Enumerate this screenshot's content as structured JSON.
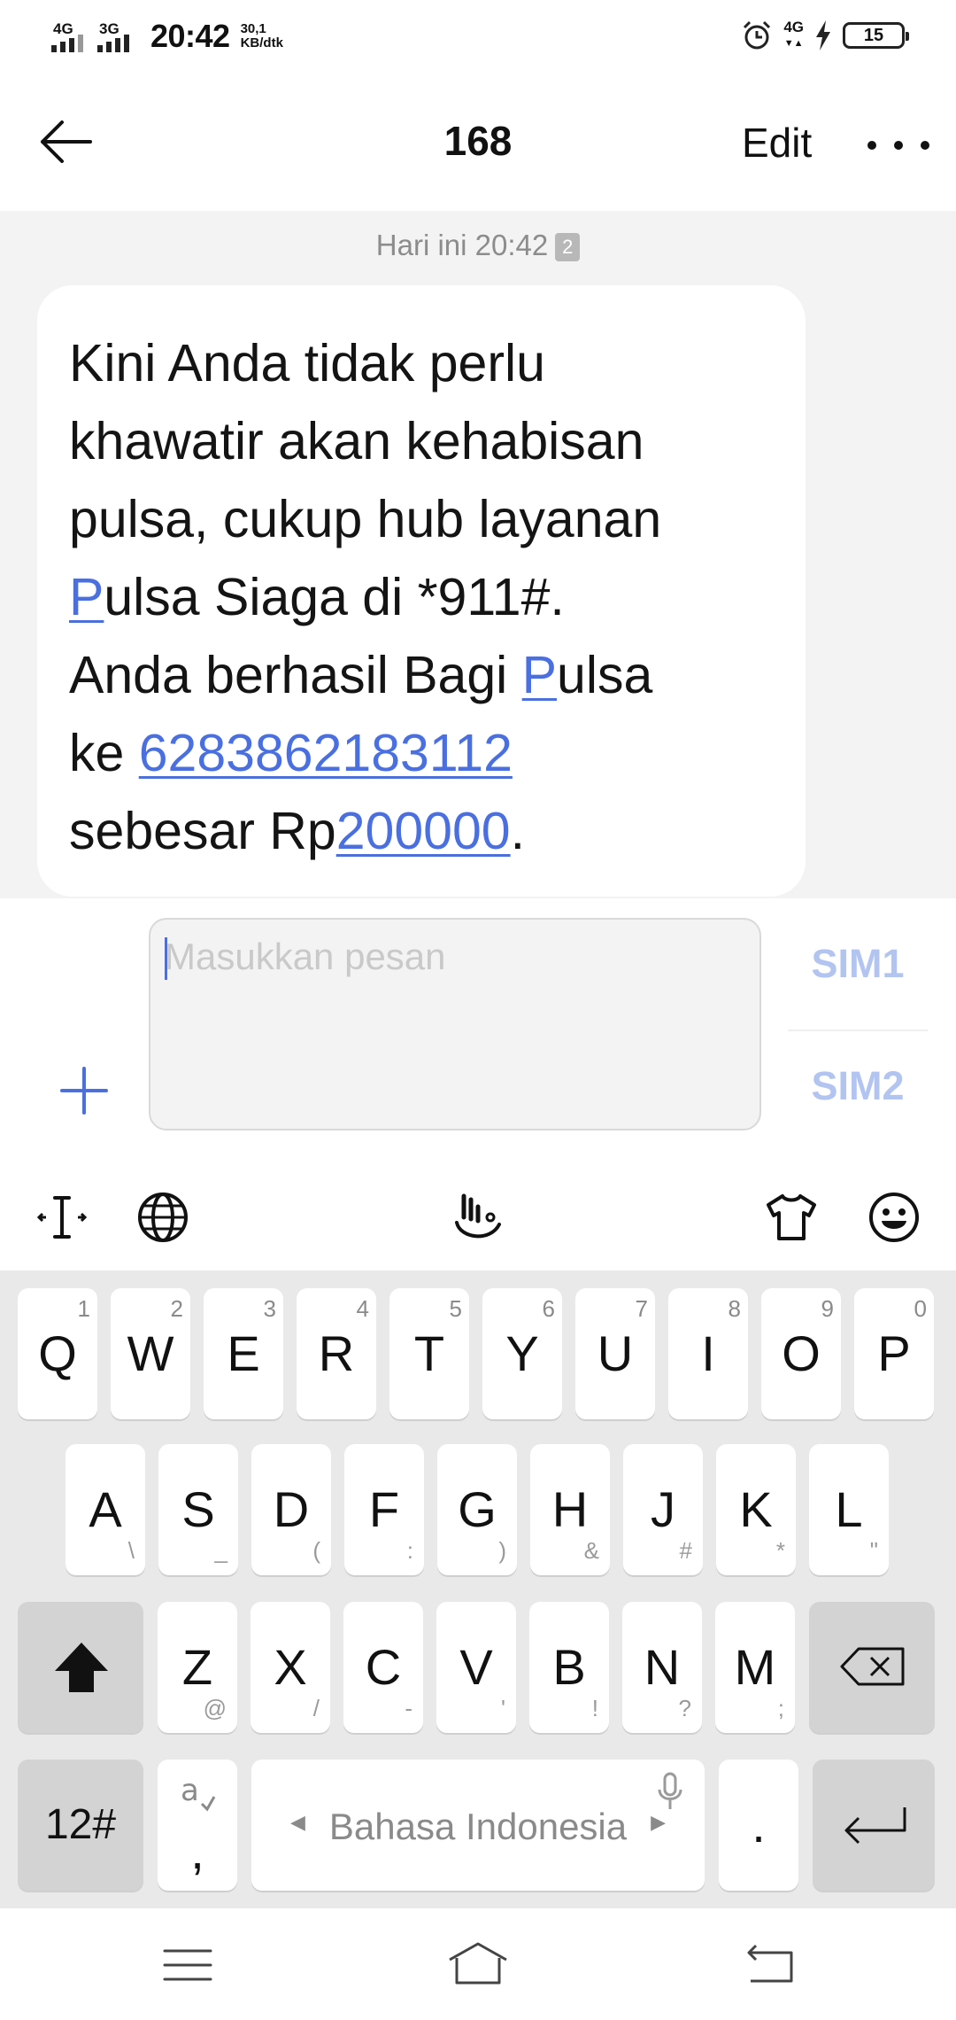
{
  "status_bar": {
    "sim1_network": "4G",
    "sim2_network": "3G",
    "time": "20:42",
    "speed_value": "30,1",
    "speed_unit": "KB/dtk",
    "network_right": "4G",
    "battery_level": "15"
  },
  "header": {
    "title": "168",
    "edit_label": "Edit"
  },
  "conversation": {
    "timestamp": "Hari ini 20:42",
    "sim_badge": "2",
    "message": {
      "line1": "Kini Anda tidak perlu",
      "line2": "khawatir akan kehabisan",
      "line3": "pulsa, cukup hub layanan",
      "line4_link": "P",
      "line4_rest": "ulsa Siaga di *911#.",
      "line5_text": "Anda berhasil Bagi ",
      "line5_link": "P",
      "line5_rest": "ulsa",
      "line6_text": "ke ",
      "line6_link": "6283862183112",
      "line7_text": "sebesar Rp",
      "line7_link": "200000",
      "line7_end": "."
    }
  },
  "compose": {
    "placeholder": "Masukkan pesan",
    "sim1_label": "SIM1",
    "sim2_label": "SIM2"
  },
  "keyboard": {
    "row1": [
      {
        "main": "Q",
        "hint": "1"
      },
      {
        "main": "W",
        "hint": "2"
      },
      {
        "main": "E",
        "hint": "3"
      },
      {
        "main": "R",
        "hint": "4"
      },
      {
        "main": "T",
        "hint": "5"
      },
      {
        "main": "Y",
        "hint": "6"
      },
      {
        "main": "U",
        "hint": "7"
      },
      {
        "main": "I",
        "hint": "8"
      },
      {
        "main": "O",
        "hint": "9"
      },
      {
        "main": "P",
        "hint": "0"
      }
    ],
    "row2": [
      {
        "main": "A",
        "hint": "\\"
      },
      {
        "main": "S",
        "hint": "_"
      },
      {
        "main": "D",
        "hint": "("
      },
      {
        "main": "F",
        "hint": ":"
      },
      {
        "main": "G",
        "hint": ")"
      },
      {
        "main": "H",
        "hint": "&"
      },
      {
        "main": "J",
        "hint": "#"
      },
      {
        "main": "K",
        "hint": "*"
      },
      {
        "main": "L",
        "hint": "\""
      }
    ],
    "row3": [
      {
        "main": "Z",
        "hint": "@"
      },
      {
        "main": "X",
        "hint": "/"
      },
      {
        "main": "C",
        "hint": "-"
      },
      {
        "main": "V",
        "hint": "'"
      },
      {
        "main": "B",
        "hint": "!"
      },
      {
        "main": "N",
        "hint": "?"
      },
      {
        "main": "M",
        "hint": ";"
      }
    ],
    "numbers_label": "12#",
    "comma_label": ",",
    "space_label": "Bahasa Indonesia",
    "period_label": "."
  },
  "colors": {
    "link": "#4a6fe0",
    "sim_button": "#b2c4f0",
    "conversation_bg": "#f3f3f3",
    "keyboard_bg": "#e9e9e9"
  }
}
